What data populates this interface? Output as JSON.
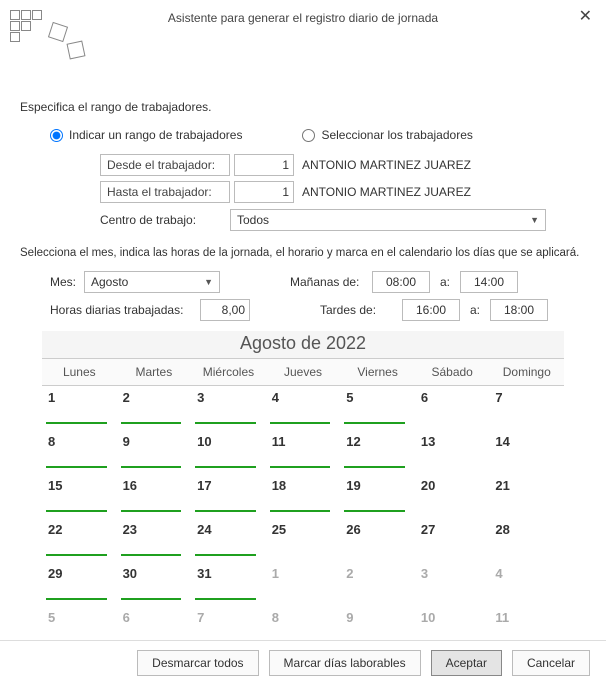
{
  "window": {
    "title": "Asistente para generar el registro diario de jornada"
  },
  "section1_label": "Especifica el rango de trabajadores.",
  "radio": {
    "indicate_range": "Indicar un rango de trabajadores",
    "select_workers": "Seleccionar los trabajadores",
    "selected": "indicate_range"
  },
  "range": {
    "from_label": "Desde el trabajador:",
    "to_label": "Hasta el trabajador:",
    "from_value": "1",
    "to_value": "1",
    "from_name": "ANTONIO MARTINEZ JUAREZ",
    "to_name": "ANTONIO MARTINEZ JUAREZ"
  },
  "centro": {
    "label": "Centro de trabajo:",
    "value": "Todos"
  },
  "instructions": "Selecciona el mes, indica las horas de la jornada, el horario y marca en el calendario los días que se aplicará.",
  "mes": {
    "label": "Mes:",
    "value": "Agosto"
  },
  "hours": {
    "label": "Horas diarias trabajadas:",
    "value": "8,00"
  },
  "morning": {
    "label": "Mañanas de:",
    "from": "08:00",
    "a": "a:",
    "to": "14:00"
  },
  "afternoon": {
    "label": "Tardes de:",
    "from": "16:00",
    "a": "a:",
    "to": "18:00"
  },
  "calendar": {
    "title": "Agosto de 2022",
    "weekdays": [
      "Lunes",
      "Martes",
      "Miércoles",
      "Jueves",
      "Viernes",
      "Sábado",
      "Domingo"
    ],
    "cells": [
      {
        "n": "1",
        "in": true,
        "mark": true
      },
      {
        "n": "2",
        "in": true,
        "mark": true
      },
      {
        "n": "3",
        "in": true,
        "mark": true
      },
      {
        "n": "4",
        "in": true,
        "mark": true
      },
      {
        "n": "5",
        "in": true,
        "mark": true
      },
      {
        "n": "6",
        "in": true,
        "mark": false
      },
      {
        "n": "7",
        "in": true,
        "mark": false
      },
      {
        "n": "8",
        "in": true,
        "mark": true
      },
      {
        "n": "9",
        "in": true,
        "mark": true
      },
      {
        "n": "10",
        "in": true,
        "mark": true
      },
      {
        "n": "11",
        "in": true,
        "mark": true
      },
      {
        "n": "12",
        "in": true,
        "mark": true
      },
      {
        "n": "13",
        "in": true,
        "mark": false
      },
      {
        "n": "14",
        "in": true,
        "mark": false
      },
      {
        "n": "15",
        "in": true,
        "mark": true
      },
      {
        "n": "16",
        "in": true,
        "mark": true
      },
      {
        "n": "17",
        "in": true,
        "mark": true
      },
      {
        "n": "18",
        "in": true,
        "mark": true
      },
      {
        "n": "19",
        "in": true,
        "mark": true
      },
      {
        "n": "20",
        "in": true,
        "mark": false
      },
      {
        "n": "21",
        "in": true,
        "mark": false
      },
      {
        "n": "22",
        "in": true,
        "mark": true
      },
      {
        "n": "23",
        "in": true,
        "mark": true
      },
      {
        "n": "24",
        "in": true,
        "mark": true
      },
      {
        "n": "25",
        "in": true,
        "mark": false
      },
      {
        "n": "26",
        "in": true,
        "mark": false
      },
      {
        "n": "27",
        "in": true,
        "mark": false
      },
      {
        "n": "28",
        "in": true,
        "mark": false
      },
      {
        "n": "29",
        "in": true,
        "mark": true
      },
      {
        "n": "30",
        "in": true,
        "mark": true
      },
      {
        "n": "31",
        "in": true,
        "mark": true
      },
      {
        "n": "1",
        "in": false,
        "mark": false
      },
      {
        "n": "2",
        "in": false,
        "mark": false
      },
      {
        "n": "3",
        "in": false,
        "mark": false
      },
      {
        "n": "4",
        "in": false,
        "mark": false
      },
      {
        "n": "5",
        "in": false,
        "mark": false
      },
      {
        "n": "6",
        "in": false,
        "mark": false
      },
      {
        "n": "7",
        "in": false,
        "mark": false
      },
      {
        "n": "8",
        "in": false,
        "mark": false
      },
      {
        "n": "9",
        "in": false,
        "mark": false
      },
      {
        "n": "10",
        "in": false,
        "mark": false
      },
      {
        "n": "11",
        "in": false,
        "mark": false
      }
    ]
  },
  "buttons": {
    "unmark_all": "Desmarcar todos",
    "mark_workdays": "Marcar días laborables",
    "accept": "Aceptar",
    "cancel": "Cancelar"
  }
}
